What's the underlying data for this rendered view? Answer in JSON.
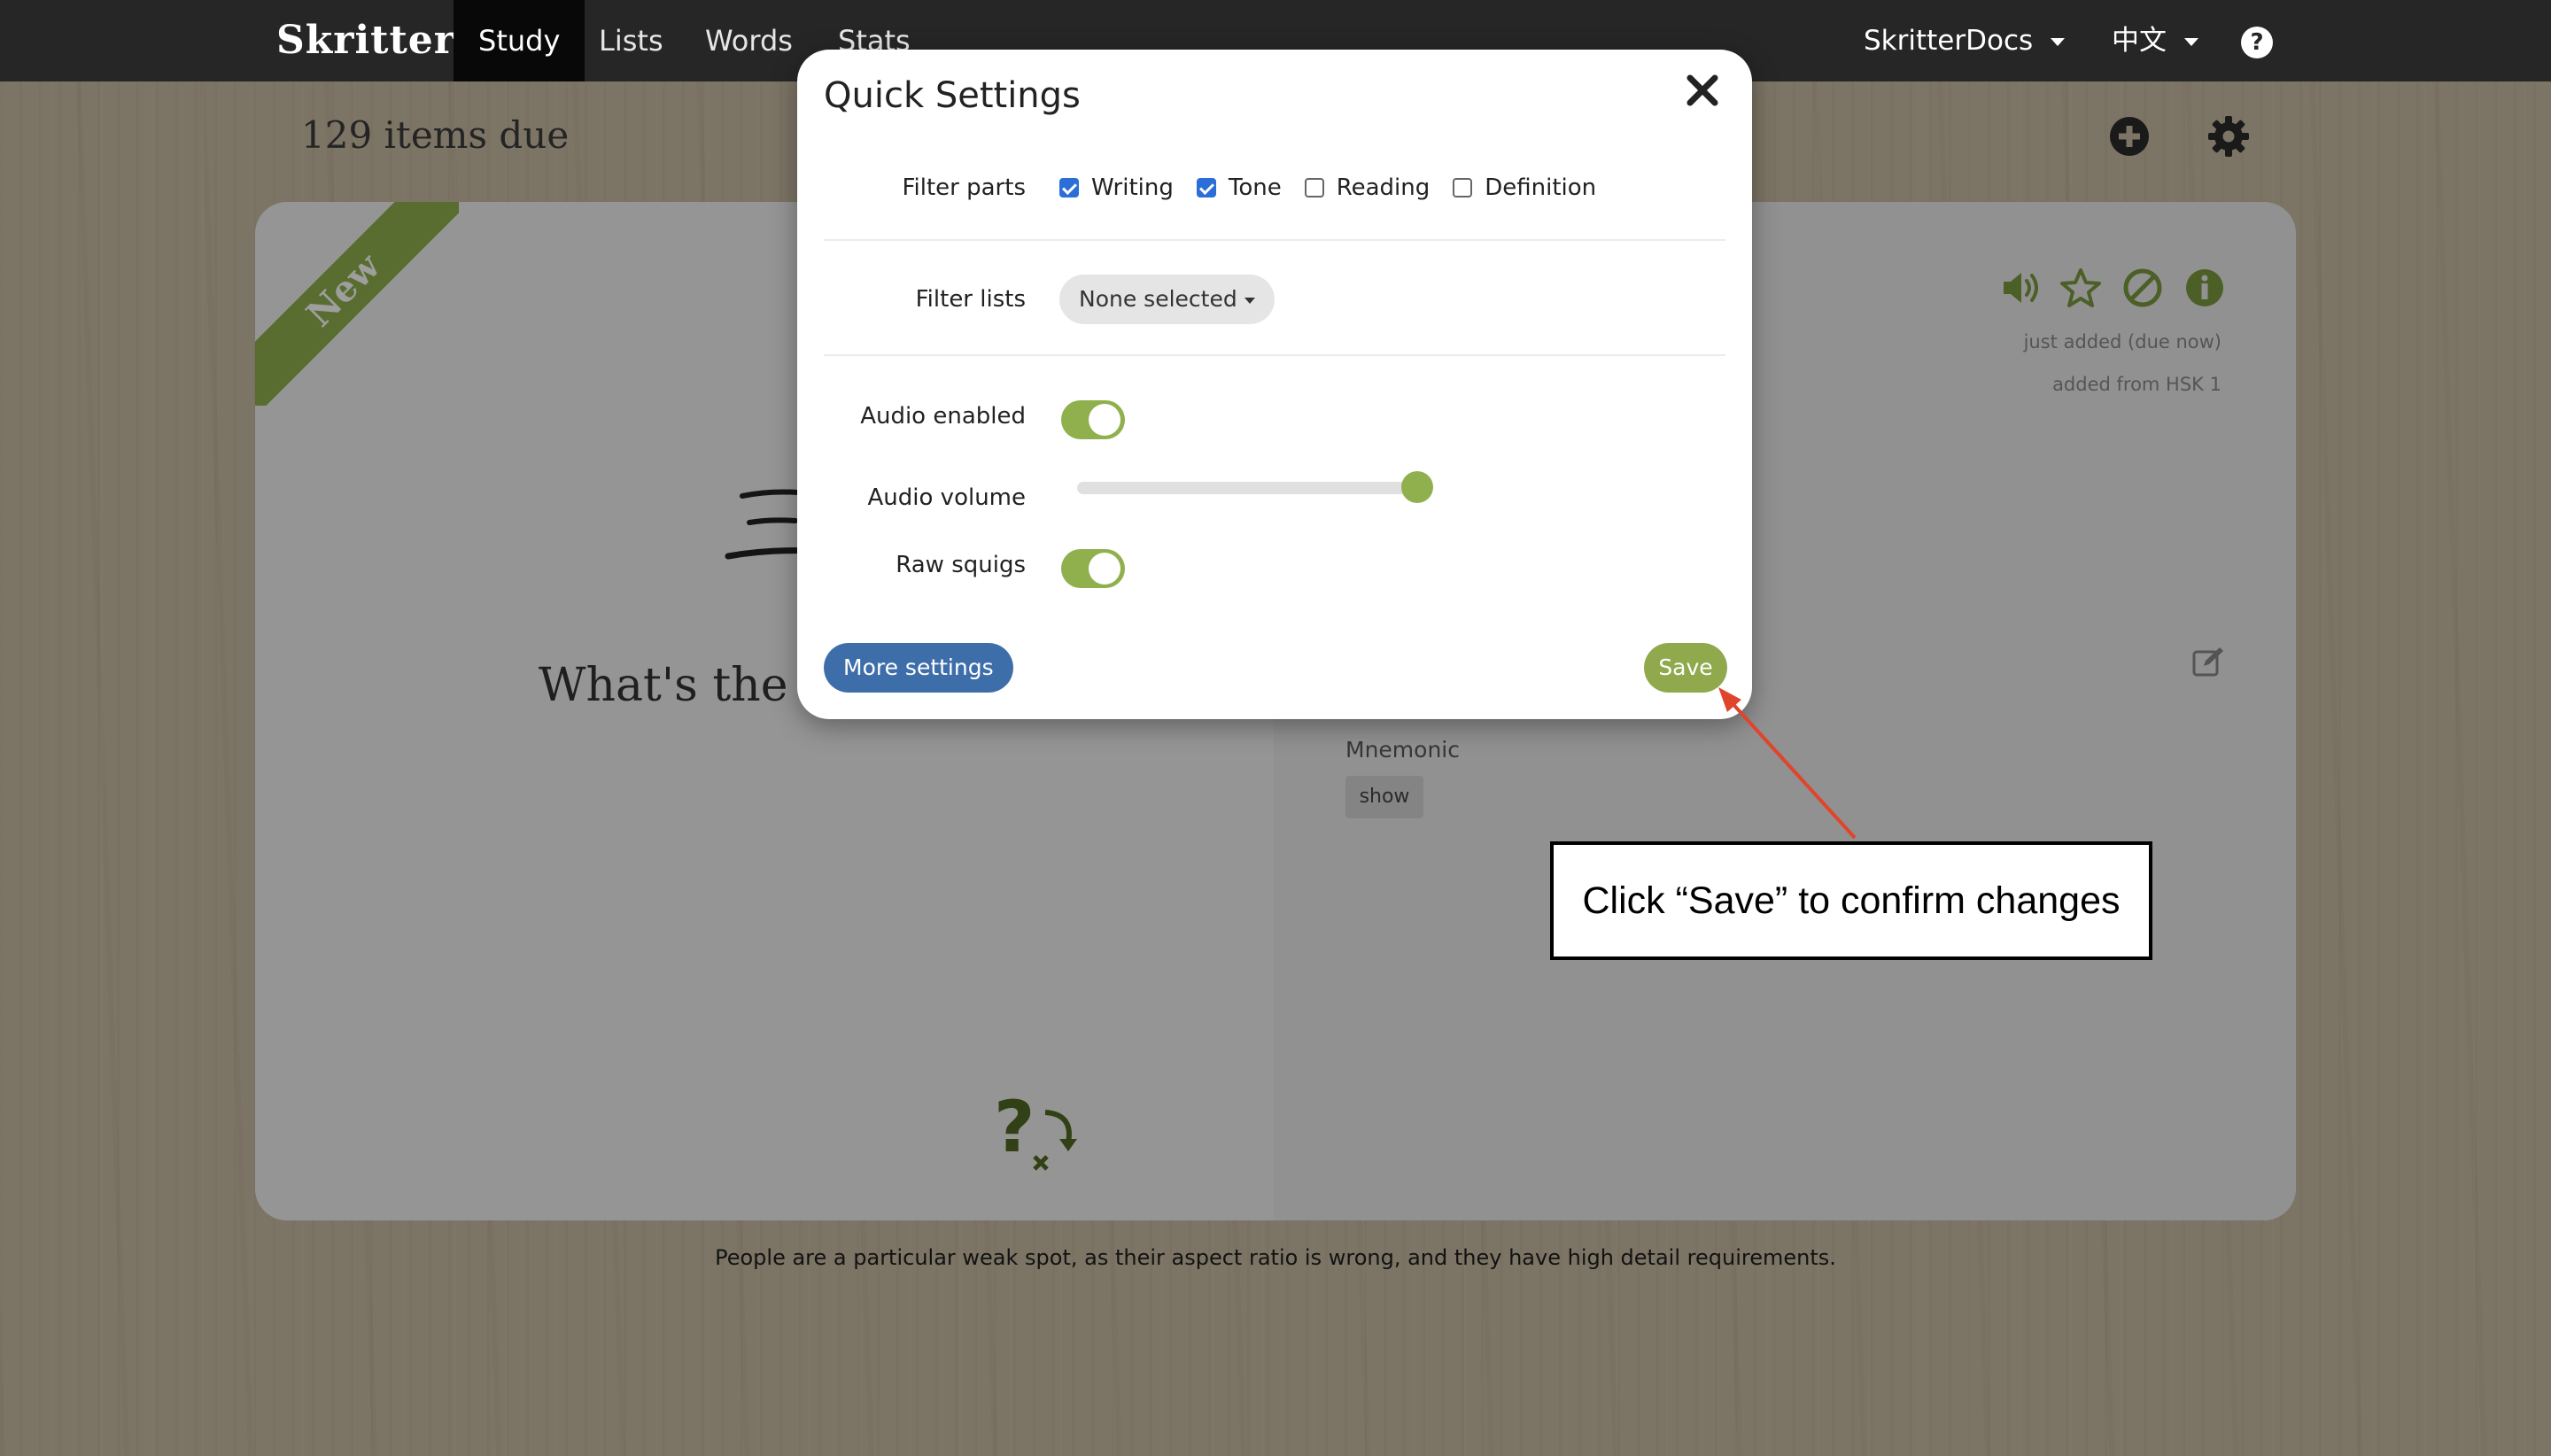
{
  "navbar": {
    "brand": "Skritter",
    "links": [
      "Study",
      "Lists",
      "Words",
      "Stats"
    ],
    "user_menu": "SkritterDocs",
    "language_menu": "中文",
    "help": "?"
  },
  "header": {
    "items_due": "129 items due",
    "icons": [
      "plus-circle-icon",
      "gear-icon"
    ]
  },
  "card": {
    "ribbon": "New",
    "prompt": "What's the d",
    "meta_lines": [
      "just added (due now)",
      "added from HSK 1"
    ],
    "mnemonic_label": "Mnemonic",
    "mnemonic_button": "show",
    "icons": [
      "speaker-icon",
      "star-icon",
      "ban-icon",
      "info-icon",
      "edit-icon",
      "skip-question-icon"
    ]
  },
  "footer": {
    "text": "People are a particular weak spot, as their aspect ratio is wrong, and they have high detail requirements."
  },
  "modal": {
    "title": "Quick Settings",
    "filter_parts": {
      "label": "Filter parts",
      "options": [
        {
          "label": "Writing",
          "checked": true
        },
        {
          "label": "Tone",
          "checked": true
        },
        {
          "label": "Reading",
          "checked": false
        },
        {
          "label": "Definition",
          "checked": false
        }
      ]
    },
    "filter_lists": {
      "label": "Filter lists",
      "value": "None selected"
    },
    "audio_enabled": {
      "label": "Audio enabled",
      "on": true
    },
    "audio_volume": {
      "label": "Audio volume",
      "value": 1.0
    },
    "raw_squigs": {
      "label": "Raw squigs",
      "on": true
    },
    "more_settings": "More settings",
    "save": "Save"
  },
  "annotation": {
    "callout": "Click “Save” to confirm changes"
  },
  "colors": {
    "accent_green": "#8fb04c",
    "primary_blue": "#3e6eaa",
    "navbar": "#262626",
    "checkbox_blue": "#2b6ed8",
    "arrow_red": "#e0442b"
  }
}
